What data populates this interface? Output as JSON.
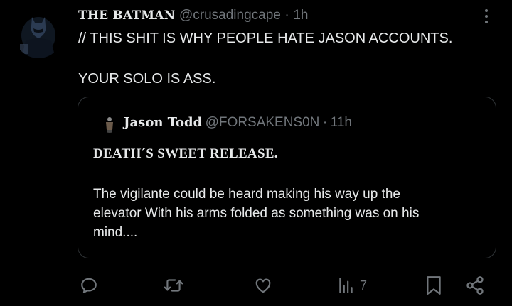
{
  "tweet": {
    "display_name": "THE BATMAN",
    "handle": "@crusadingcape",
    "separator": "·",
    "time": "1h",
    "text_line1": "// THIS SHIT IS WHY PEOPLE HATE JASON ACCOUNTS.",
    "text_line2": "YOUR SOLO IS ASS.",
    "avatar_icon": "batman-avatar",
    "more_icon": "more-vertical-icon"
  },
  "quote": {
    "display_name": "Jason Todd",
    "handle": "@FORSAKENS0N",
    "separator": "·",
    "time": "11h",
    "title": "DEATH´S  SWEET RELEASE.",
    "lines": [
      "The vigilante could be heard making his way up the",
      "elevator With his arms folded as something was on his",
      "mind...."
    ]
  },
  "actions": {
    "reply_icon": "reply-icon",
    "retweet_icon": "retweet-icon",
    "like_icon": "like-icon",
    "views_icon": "views-icon",
    "views_count": "7",
    "bookmark_icon": "bookmark-icon",
    "share_icon": "share-icon"
  },
  "colors": {
    "background": "#000000",
    "text": "#e7e9ea",
    "secondary": "#71767b",
    "border": "#2f3336"
  }
}
